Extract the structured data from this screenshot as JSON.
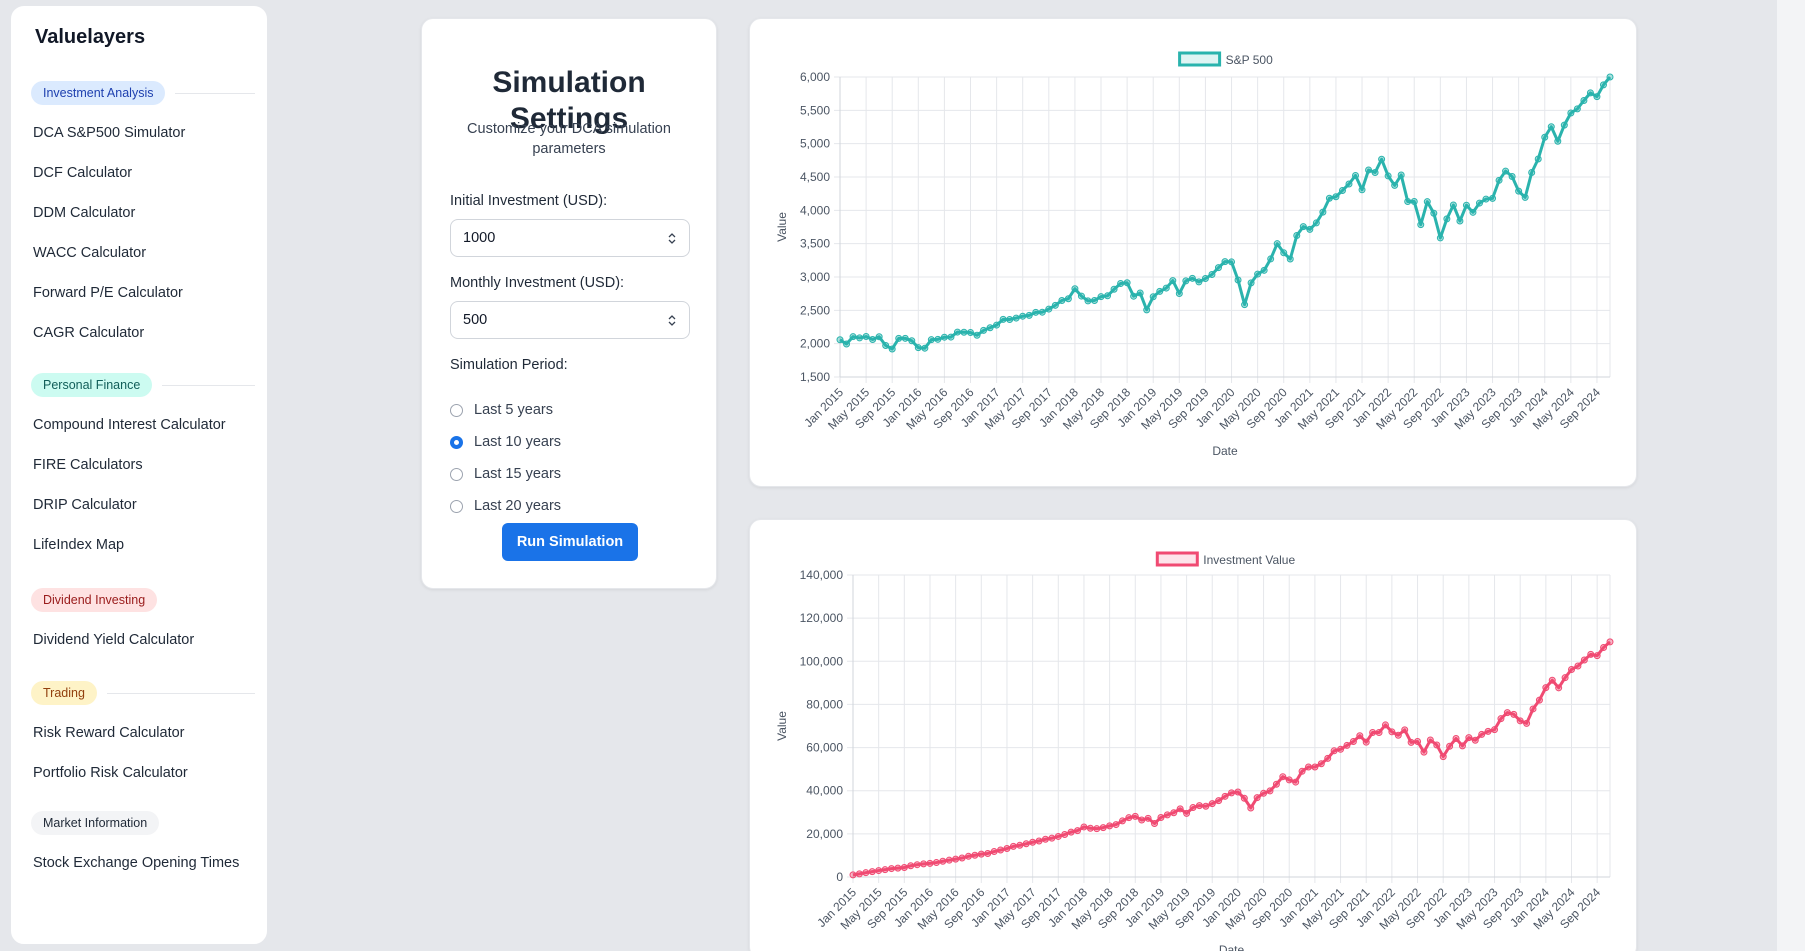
{
  "sidebar": {
    "brand": "Valuelayers",
    "sections": [
      {
        "label": "Investment Analysis",
        "pill_bg": "#dbeafe",
        "pill_fg": "#1e40af",
        "items": [
          "DCA S&P500 Simulator",
          "DCF Calculator",
          "DDM Calculator",
          "WACC Calculator",
          "Forward P/E Calculator",
          "CAGR Calculator"
        ]
      },
      {
        "label": "Personal Finance",
        "pill_bg": "#ccfbf1",
        "pill_fg": "#115e59",
        "items": [
          "Compound Interest Calculator",
          "FIRE Calculators",
          "DRIP Calculator",
          "LifeIndex Map"
        ]
      },
      {
        "label": "Dividend Investing",
        "pill_bg": "#fee2e2",
        "pill_fg": "#991b1b",
        "items": [
          "Dividend Yield Calculator"
        ]
      },
      {
        "label": "Trading",
        "pill_bg": "#fef3c7",
        "pill_fg": "#92400e",
        "items": [
          "Risk Reward Calculator",
          "Portfolio Risk Calculator"
        ]
      },
      {
        "label": "Market Information",
        "pill_bg": "#f3f4f6",
        "pill_fg": "#1f2937",
        "items": [
          "Stock Exchange Opening Times"
        ]
      }
    ]
  },
  "settings": {
    "title": "Simulation Settings",
    "subtitle": "Customize your DCA simulation parameters",
    "initial_label": "Initial Investment (USD):",
    "initial_value": "1000",
    "monthly_label": "Monthly Investment (USD):",
    "monthly_value": "500",
    "period_label": "Simulation Period:",
    "periods": [
      "Last 5 years",
      "Last 10 years",
      "Last 15 years",
      "Last 20 years"
    ],
    "selected_period": 1,
    "run_label": "Run Simulation",
    "accent": "#1a73e8"
  },
  "chart_data": [
    {
      "type": "line",
      "legend": "S&P 500",
      "legend_position": "top",
      "color": "#2ab3ad",
      "ylabel": "Value",
      "xlabel": "Date",
      "ylim": [
        1500,
        6000
      ],
      "yticks": [
        "1,500",
        "2,000",
        "2,500",
        "3,000",
        "3,500",
        "4,000",
        "4,500",
        "5,000",
        "5,500",
        "6,000"
      ],
      "xticks": [
        "Jan 2015",
        "May 2015",
        "Sep 2015",
        "Jan 2016",
        "May 2016",
        "Sep 2016",
        "Jan 2017",
        "May 2017",
        "Sep 2017",
        "Jan 2018",
        "May 2018",
        "Sep 2018",
        "Jan 2019",
        "May 2019",
        "Sep 2019",
        "Jan 2020",
        "May 2020",
        "Sep 2020",
        "Jan 2021",
        "May 2021",
        "Sep 2021",
        "Jan 2022",
        "May 2022",
        "Sep 2022",
        "Jan 2023",
        "May 2023",
        "Sep 2023",
        "Jan 2024",
        "May 2024",
        "Sep 2024"
      ],
      "grid": true,
      "values": [
        2059,
        1995,
        2105,
        2086,
        2107,
        2063,
        2104,
        1973,
        1920,
        2079,
        2080,
        2044,
        1940,
        1932,
        2060,
        2065,
        2097,
        2099,
        2174,
        2171,
        2168,
        2126,
        2199,
        2239,
        2279,
        2364,
        2363,
        2384,
        2412,
        2424,
        2470,
        2472,
        2519,
        2575,
        2648,
        2674,
        2824,
        2714,
        2641,
        2648,
        2705,
        2718,
        2816,
        2902,
        2914,
        2712,
        2760,
        2507,
        2704,
        2784,
        2834,
        2946,
        2752,
        2942,
        2980,
        2926,
        2977,
        3038,
        3141,
        3231,
        3226,
        2955,
        2585,
        2912,
        3044,
        3100,
        3271,
        3500,
        3363,
        3270,
        3622,
        3756,
        3714,
        3811,
        3973,
        4181,
        4204,
        4298,
        4395,
        4523,
        4308,
        4605,
        4567,
        4766,
        4516,
        4374,
        4530,
        4132,
        4132,
        3785,
        4130,
        3956,
        3586,
        3872,
        4080,
        3840,
        4077,
        3970,
        4109,
        4169,
        4179,
        4450,
        4589,
        4508,
        4288,
        4194,
        4568,
        4770,
        5096,
        5254,
        5036,
        5278,
        5460,
        5522,
        5648,
        5762,
        5705,
        5882,
        6000
      ]
    },
    {
      "type": "line",
      "legend": "Investment Value",
      "legend_position": "top",
      "color": "#f04a72",
      "ylabel": "Value",
      "xlabel": "Date",
      "ylim": [
        0,
        140000
      ],
      "yticks": [
        "0",
        "20,000",
        "40,000",
        "60,000",
        "80,000",
        "100,000",
        "120,000",
        "140,000"
      ],
      "xticks": [
        "Jan 2015",
        "May 2015",
        "Sep 2015",
        "Jan 2016",
        "May 2016",
        "Sep 2016",
        "Jan 2017",
        "May 2017",
        "Sep 2017",
        "Jan 2018",
        "May 2018",
        "Sep 2018",
        "Jan 2019",
        "May 2019",
        "Sep 2019",
        "Jan 2020",
        "May 2020",
        "Sep 2020",
        "Jan 2021",
        "May 2021",
        "Sep 2021",
        "Jan 2022",
        "May 2022",
        "Sep 2022",
        "Jan 2023",
        "May 2023",
        "Sep 2023",
        "Jan 2024",
        "May 2024",
        "Sep 2024"
      ],
      "grid": true,
      "values": [
        1000,
        1450,
        2000,
        2480,
        2980,
        3400,
        3900,
        4100,
        4400,
        5200,
        5700,
        6100,
        6300,
        6700,
        7300,
        7800,
        8300,
        8800,
        9600,
        10100,
        10600,
        10900,
        11800,
        12500,
        13200,
        14200,
        14700,
        15400,
        16100,
        16700,
        17500,
        18000,
        18800,
        19700,
        20800,
        21500,
        23200,
        22600,
        22400,
        22900,
        23700,
        24300,
        26000,
        27500,
        28100,
        26400,
        27200,
        24800,
        27600,
        28800,
        29800,
        31600,
        29500,
        32200,
        33100,
        32800,
        34000,
        35400,
        37400,
        39000,
        39400,
        36500,
        32000,
        36800,
        38800,
        39900,
        43000,
        46500,
        45000,
        44000,
        49000,
        51000,
        51000,
        52500,
        55000,
        58500,
        59200,
        61000,
        62800,
        65500,
        62500,
        67000,
        67000,
        70500,
        67300,
        65700,
        68200,
        62400,
        62800,
        57900,
        63500,
        61200,
        55800,
        60600,
        64200,
        60800,
        64600,
        63400,
        66100,
        67500,
        68300,
        73400,
        76200,
        75400,
        72400,
        71200,
        77900,
        82000,
        87800,
        91200,
        87700,
        92400,
        96200,
        97800,
        100600,
        103200,
        102600,
        106400,
        109000
      ]
    }
  ]
}
